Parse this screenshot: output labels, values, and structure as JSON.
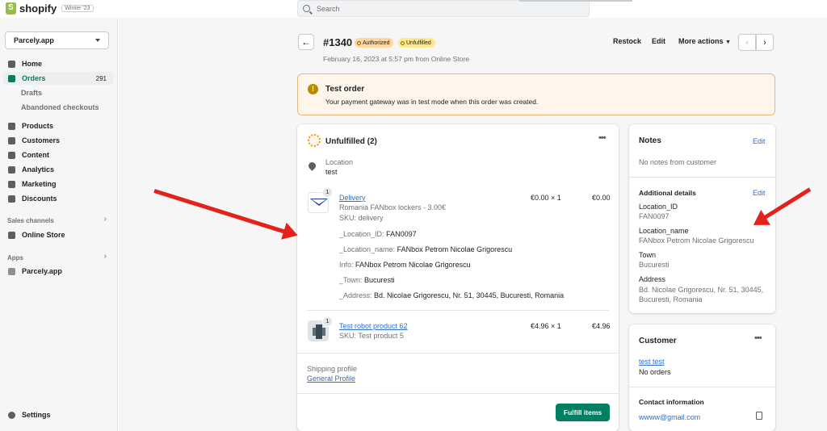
{
  "topbar": {
    "brand": "shopify",
    "edition": "Winter '23",
    "search_placeholder": "Search"
  },
  "sidebar": {
    "store": "Parcely.app",
    "items": [
      {
        "label": "Home",
        "icon": "home-icon"
      },
      {
        "label": "Orders",
        "icon": "orders-icon",
        "count": "291",
        "active": true
      },
      {
        "label": "Drafts"
      },
      {
        "label": "Abandoned checkouts"
      },
      {
        "label": "Products",
        "icon": "tag-icon"
      },
      {
        "label": "Customers",
        "icon": "person-icon"
      },
      {
        "label": "Content",
        "icon": "content-icon"
      },
      {
        "label": "Analytics",
        "icon": "bar-chart-icon"
      },
      {
        "label": "Marketing",
        "icon": "target-icon"
      },
      {
        "label": "Discounts",
        "icon": "discount-icon"
      }
    ],
    "sales_channels_label": "Sales channels",
    "online_store": "Online Store",
    "apps_label": "Apps",
    "app_item": "Parcely.app",
    "settings": "Settings"
  },
  "order": {
    "number": "#1340",
    "badge_authorized": "Authorized",
    "badge_unfulfilled": "Unfulfilled",
    "date": "February 16, 2023 at 5:57 pm from Online Store",
    "actions": {
      "restock": "Restock",
      "edit": "Edit",
      "more": "More actions"
    }
  },
  "banner": {
    "title": "Test order",
    "body": "Your payment gateway was in test mode when this order was created."
  },
  "fulfillment": {
    "title": "Unfulfilled (2)",
    "location_label": "Location",
    "location_value": "test",
    "items": [
      {
        "qty": "1",
        "name": "Delivery",
        "variant": "Romania FANbox lockers - 3.00€",
        "sku": "SKU: delivery",
        "price": "€0.00 × 1",
        "total": "€0.00",
        "props": [
          {
            "k": "_Location_ID:",
            "v": "FAN0097"
          },
          {
            "k": "_Location_name:",
            "v": "FANbox Petrom Nicolae Grigorescu"
          },
          {
            "k": "Info:",
            "v": "FANbox Petrom Nicolae Grigorescu"
          },
          {
            "k": "_Town:",
            "v": "Bucuresti"
          },
          {
            "k": "_Address:",
            "v": "Bd. Nicolae Grigorescu, Nr. 51, 30445, Bucuresti, Romania"
          }
        ]
      },
      {
        "qty": "1",
        "name": "Test robot product 62",
        "sku": "SKU: Test product 5",
        "price": "€4.96 × 1",
        "total": "€4.96"
      }
    ],
    "shipping_profile_label": "Shipping profile",
    "shipping_profile_link": "General Profile",
    "fulfill_button": "Fulfill items"
  },
  "notes": {
    "title": "Notes",
    "edit": "Edit",
    "empty": "No notes from customer",
    "additional_title": "Additional details",
    "additional_edit": "Edit",
    "details": [
      {
        "k": "Location_ID",
        "v": "FAN0097"
      },
      {
        "k": "Location_name",
        "v": "FANbox Petrom Nicolae Grigorescu"
      },
      {
        "k": "Town",
        "v": "Bucuresti"
      },
      {
        "k": "Address",
        "v": "Bd. Nicolae Grigorescu, Nr. 51, 30445, Bucuresti, Romania"
      }
    ]
  },
  "customer": {
    "title": "Customer",
    "name": "test test",
    "orders": "No orders",
    "contact_title": "Contact information",
    "email": "wwww@gmail.com"
  },
  "colors": {
    "accent": "#008060",
    "arrow": "#e3221b",
    "link": "#2c6ecb"
  }
}
